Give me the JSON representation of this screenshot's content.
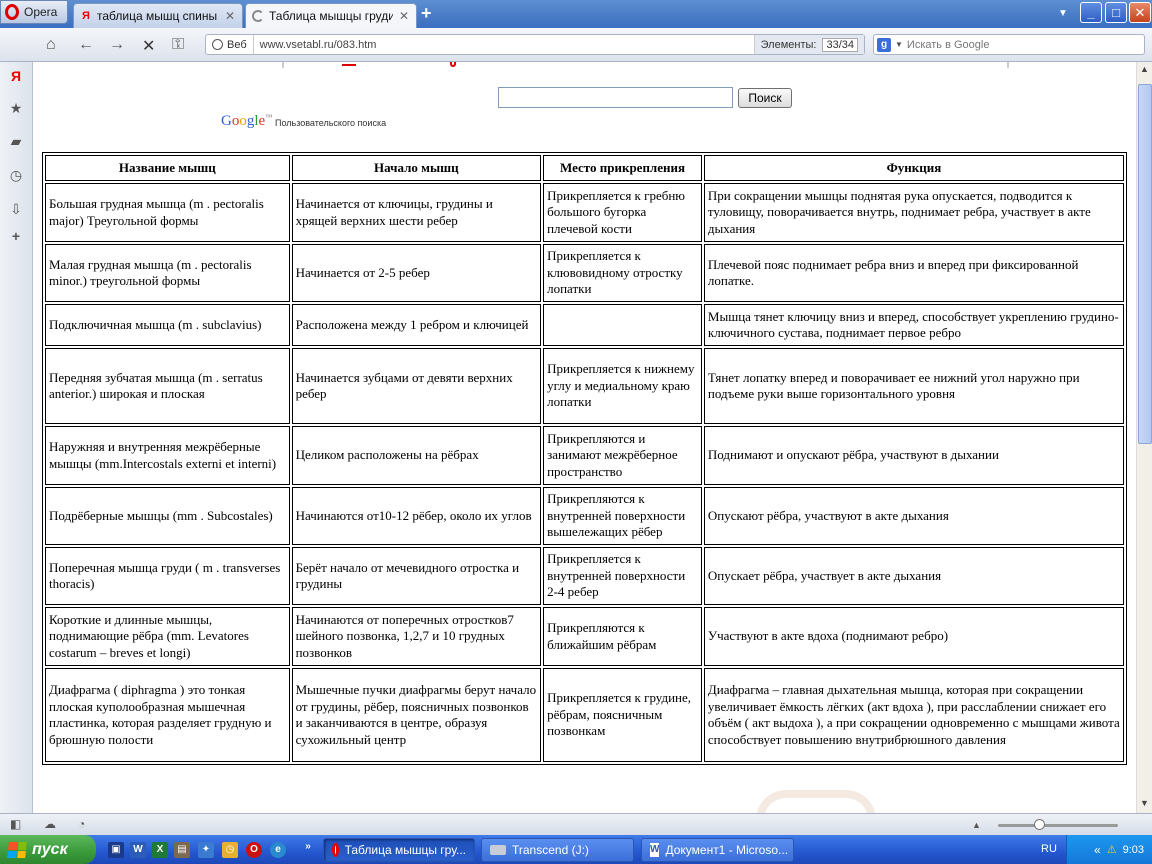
{
  "browser": {
    "menu_label": "Opera",
    "tabs": [
      {
        "title": "таблица мышц спины г...",
        "active": false
      },
      {
        "title": "Таблица мышцы груди ...",
        "active": true
      }
    ],
    "new_tab": "+",
    "web_label": "Веб",
    "url": "www.vsetabl.ru/083.htm",
    "elements_label": "Элементы:",
    "elements_count": "33/34",
    "search_placeholder": "Искать в Google"
  },
  "page": {
    "search_button": "Поиск",
    "google_logo": {
      "G": "G",
      "o1": "o",
      "o2": "o",
      "g": "g",
      "l": "l",
      "e": "e",
      "tm": "™"
    },
    "custom_search_label": "Пользовательского поиска",
    "table": {
      "headers": [
        "Название мышц",
        "Начало мышц",
        "Место прикрепления",
        "Функция"
      ],
      "rows": [
        [
          "Большая грудная мышца (m . pectoralis major) Треугольной формы",
          "Начинается от ключицы, грудины и хрящей верхних шести ребер",
          "Прикрепляется к гребню большого бугорка плечевой кости",
          "При сокращении мышцы поднятая рука опускается, подводится к туловищу, поворачивается внутрь, поднимает ребра, участвует в акте дыхания"
        ],
        [
          "Малая грудная мышца (m . pectoralis minor.) треугольной формы",
          "Начинается от 2-5 ребер",
          "Прикрепляется к клювовидному отростку лопатки",
          "Плечевой пояс поднимает ребра вниз и вперед при фиксированной лопатке."
        ],
        [
          "Подключичная мышца (m . subclavius)",
          "Расположена между 1 ребром и ключицей",
          "",
          "Мышца тянет ключицу вниз и вперед, способствует укреплению грудино-ключичного сустава, поднимает первое ребро"
        ],
        [
          "Передняя зубчатая мышца (m . serratus anterior.) широкая и плоская",
          "Начинается зубцами от девяти верхних ребер",
          "Прикрепляется к нижнему углу и медиальному краю лопатки",
          "Тянет лопатку вперед и поворачивает ее нижний угол наружно при подъеме руки выше горизонтального уровня"
        ],
        [
          "Наружняя и внутренняя межрёберные мышцы (mm.Intercostals externi et interni)",
          "Целиком расположены на рёбрах",
          "Прикрепляются и занимают межрёберное пространство",
          "Поднимают и опускают рёбра, участвуют в дыхании"
        ],
        [
          "Подрёберные мышцы (mm . Subcostales)",
          "Начинаются от10-12 рёбер, около их углов",
          "Прикрепляются к внутренней поверхности вышележащих рёбер",
          "Опускают рёбра, участвуют в акте дыхания"
        ],
        [
          "Поперечная мышца груди ( m . transverses thoracis)",
          "Берёт начало от мечевидного отростка и грудины",
          "Прикрепляется к внутренней поверхности 2-4 ребер",
          "Опускает рёбра, участвует в акте дыхания"
        ],
        [
          "Короткие и длинные мышцы, поднимающие рёбра (mm. Levatores costarum – breves et longi)",
          "Начинаются от поперечных отростков7 шейного позвонка, 1,2,7 и 10 грудных позвонков",
          "Прикрепляются к ближайшим рёбрам",
          "Участвуют в акте вдоха (поднимают ребро)"
        ],
        [
          "Диафрагма ( diphragma ) это тонкая плоская куполообразная мышечная пластинка, которая разделяет грудную и брюшную полости",
          "Мышечные пучки диафрагмы берут начало от грудины, рёбер, поясничных позвонков и заканчиваются в центре, образуя сухожильный центр",
          "Прикрепляется к грудине, рёбрам, поясничным позвонкам",
          "Диафрагма – главная дыхательная мышца, которая при сокращении увеличивает ёмкость лёгких (акт вдоха ), при расслаблении снижает его объём ( акт выдоха ), а при сокращении одновременно с мышцами живота способствует повышению внутрибрюшного давления"
        ]
      ]
    }
  },
  "taskbar": {
    "start_label": "пуск",
    "quicklaunch_more": "»",
    "tasks": [
      {
        "label": "Таблица мышцы гру...",
        "active": true
      },
      {
        "label": "Transcend (J:)",
        "active": false
      },
      {
        "label": "Документ1 - Microso...",
        "active": false
      }
    ],
    "language": "RU",
    "clock": "9:03"
  },
  "colors": {
    "taskbar": "#2457d0",
    "start": "#3a9a3a",
    "opera_red": "#dd0000"
  }
}
